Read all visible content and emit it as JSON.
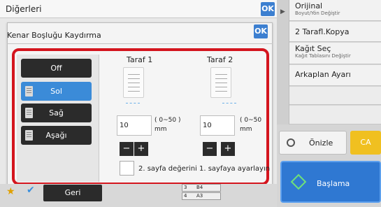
{
  "header": {
    "title": "Diğerleri",
    "ok_label": "OK"
  },
  "dialog": {
    "title": "Kenar Boşluğu Kaydırma",
    "ok_label": "OK",
    "options": [
      "Off",
      "Sol",
      "Sağ",
      "Aşağı"
    ],
    "selected_option": "Sol",
    "side1": {
      "label": "Taraf 1",
      "value": "10",
      "range": "( 0~50 )",
      "unit": "mm"
    },
    "side2": {
      "label": "Taraf 2",
      "value": "10",
      "range": "( 0~50",
      "unit": "mm"
    },
    "minus": "−",
    "plus": "+",
    "checkbox_label": "2. sayfa değerini 1. sayfaya ayarlayın",
    "checkbox_checked": false
  },
  "right_panel": {
    "items": [
      {
        "main": "Orijinal",
        "sub": "Boyut/Yön Değiştir"
      },
      {
        "main": "2 Tarafl.Kopya",
        "sub": ""
      },
      {
        "main": "Kağıt Seç",
        "sub": "Kağıt Tablasını Değiştir"
      },
      {
        "main": "Arkaplan Ayarı",
        "sub": ""
      }
    ],
    "preview_label": "Önizle",
    "ca_label": "CA",
    "start_label": "Başlama",
    "toggle_glyph": "▶"
  },
  "bottom": {
    "back_label": "Geri",
    "trays": [
      {
        "num": "3",
        "size": "B4"
      },
      {
        "num": "4",
        "size": "A3"
      }
    ]
  },
  "colors": {
    "accent": "#3b8bd8",
    "highlight_frame": "#d4151e",
    "ca": "#f0c020",
    "start": "#2f78d2"
  }
}
